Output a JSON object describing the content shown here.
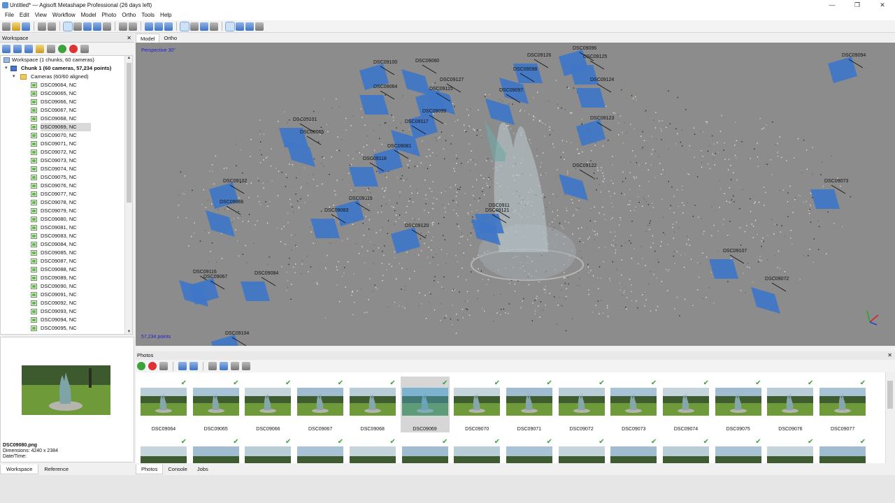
{
  "window": {
    "title": "Untitled* — Agisoft Metashape Professional (26 days left)",
    "controls": [
      "—",
      "❐",
      "✕"
    ]
  },
  "menu": [
    "File",
    "Edit",
    "View",
    "Workflow",
    "Model",
    "Photo",
    "Ortho",
    "Tools",
    "Help"
  ],
  "workspace": {
    "panel_title": "Workspace",
    "root_label": "Workspace (1 chunks, 60 cameras)",
    "chunk_label": "Chunk 1 (60 cameras, 57,234 points)",
    "cameras_label": "Cameras (60/60 aligned)",
    "selected_camera": "DSC09069, NC",
    "cameras": [
      "DSC09064, NC",
      "DSC09065, NC",
      "DSC09066, NC",
      "DSC09067, NC",
      "DSC09068, NC",
      "DSC09069, NC",
      "DSC09070, NC",
      "DSC09071, NC",
      "DSC09072, NC",
      "DSC09073, NC",
      "DSC09074, NC",
      "DSC09075, NC",
      "DSC09076, NC",
      "DSC09077, NC",
      "DSC09078, NC",
      "DSC09079, NC",
      "DSC09080, NC",
      "DSC09081, NC",
      "DSC09083, NC",
      "DSC09084, NC",
      "DSC09085, NC",
      "DSC09087, NC",
      "DSC09088, NC",
      "DSC09089, NC",
      "DSC09090, NC",
      "DSC09091, NC",
      "DSC09092, NC",
      "DSC09093, NC",
      "DSC09094, NC",
      "DSC09095, NC"
    ],
    "preview": {
      "filename": "DSC09080.png",
      "dimensions": "Dimensions: 4240 x 2384",
      "datetime": "Date/Time:"
    },
    "tabs": [
      "Workspace",
      "Reference"
    ]
  },
  "viewport": {
    "tabs": [
      "Model",
      "Ortho"
    ],
    "mode_label": "Perspective 30°",
    "points_label": "57,234 points",
    "camera_labels": [
      "DSC09096",
      "DSC09126",
      "DSC09080",
      "DSC09100",
      "DSC09125",
      "DSC09098",
      "DSC09094",
      "DSC09064",
      "DSC09127",
      "DSC09115",
      "DSC09124",
      "DSC09097",
      "DSC09099",
      "DSC09101",
      "DSC09117",
      "DSC09123",
      "DSC0911",
      "DSC09065",
      "DSC09081",
      "DSC09118",
      "DSC09122",
      "DSC09102",
      "DSC09073",
      "DSC09066",
      "DSC09119",
      "DSC09083",
      "DSC09121",
      "DSC09120",
      "DSC09107",
      "DSC09116",
      "DSC09067",
      "DSC09084",
      "DSC09072",
      "DSC09104"
    ]
  },
  "photos": {
    "panel_title": "Photos",
    "row1": [
      "DSC09064",
      "DSC09065",
      "DSC09066",
      "DSC09067",
      "DSC09068",
      "DSC09069",
      "DSC09070",
      "DSC09071",
      "DSC09072",
      "DSC09073",
      "DSC09074",
      "DSC09075",
      "DSC09076",
      "DSC09077"
    ],
    "selected": "DSC09069",
    "tabs": [
      "Photos",
      "Console",
      "Jobs"
    ]
  },
  "colors": {
    "viewport_bg": "#8c8c8c",
    "camera_plane": "#3f76c8",
    "label_blue": "#2222cc",
    "aligned_check": "#3aa33a"
  }
}
